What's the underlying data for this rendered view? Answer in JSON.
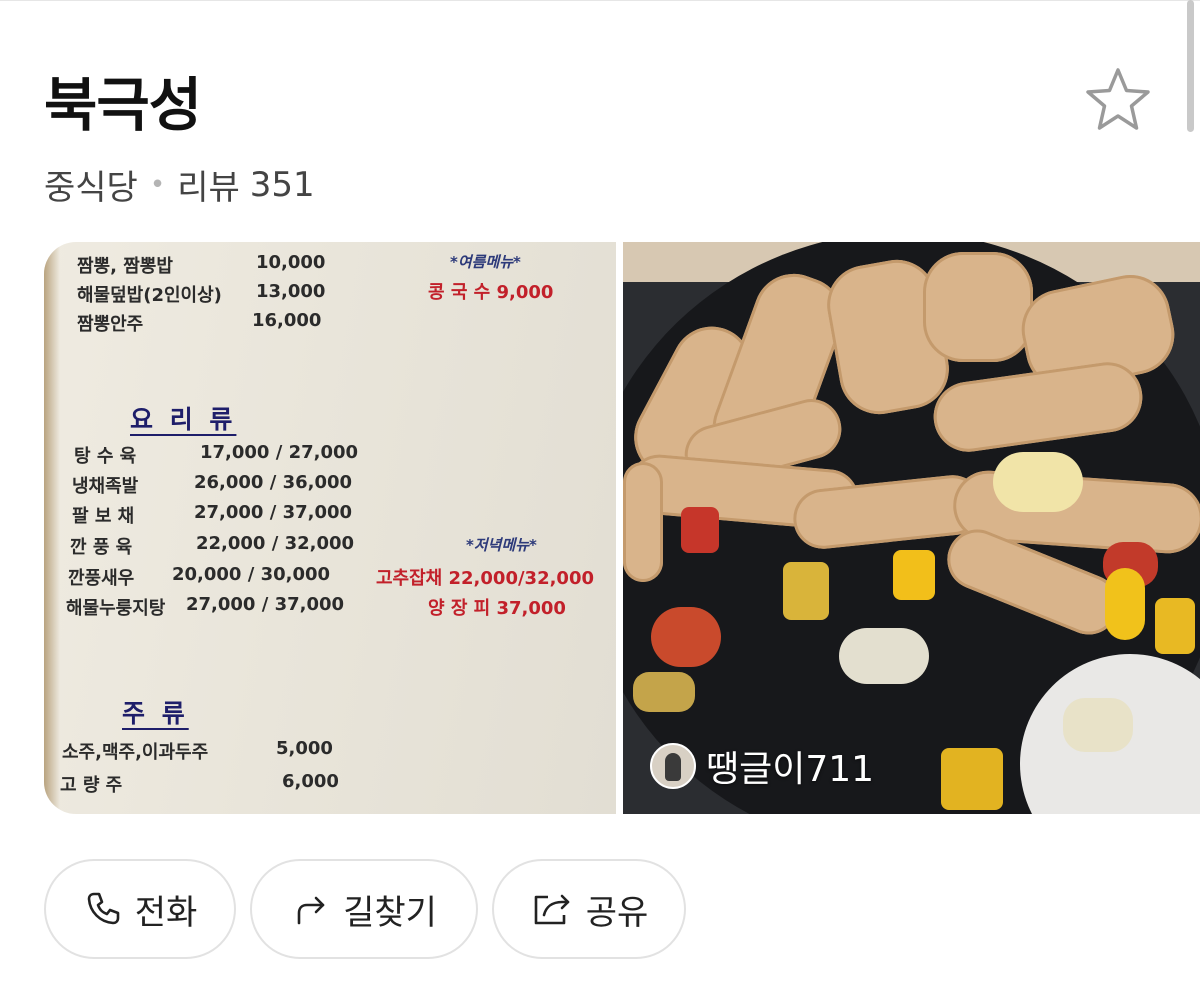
{
  "place": {
    "name": "북극성",
    "category": "중식당",
    "review_label": "리뷰",
    "review_count": "351"
  },
  "icons": {
    "favorite": "star-outline-icon",
    "call": "phone-icon",
    "directions": "route-arrow-icon",
    "share": "share-icon"
  },
  "menu_photo": {
    "rows": [
      {
        "name": "짬뽕, 짬뽕밥",
        "price": "10,000"
      },
      {
        "name": "해물덮밥(2인이상)",
        "price": "13,000"
      },
      {
        "name": "짬뽕안주",
        "price": "16,000"
      }
    ],
    "summer_title": "*여름메뉴*",
    "summer_item": "콩 국 수 9,000",
    "dishes_title": "요 리 류",
    "dishes": [
      {
        "name": "탕 수 육",
        "price": "17,000  /  27,000"
      },
      {
        "name": "냉채족발",
        "price": "26,000  /  36,000"
      },
      {
        "name": "팔 보 채",
        "price": "27,000  /  37,000"
      },
      {
        "name": "깐 풍 육",
        "price": "22,000  /  32,000"
      },
      {
        "name": "깐풍새우",
        "price": "20,000  /  30,000"
      },
      {
        "name": "해물누룽지탕",
        "price": "27,000  /  37,000"
      }
    ],
    "dinner_title": "*저녁메뉴*",
    "dinner_items": [
      "고추잡채  22,000/32,000",
      "양 장 피  37,000"
    ],
    "drinks_title": "주  류",
    "drinks": [
      {
        "name": "소주,맥주,이과두주",
        "price": "5,000"
      },
      {
        "name": "고 량 주",
        "price": "6,000"
      }
    ]
  },
  "food_photo": {
    "uploader": "땡글이711"
  },
  "actions": {
    "call": "전화",
    "directions": "길찾기",
    "share": "공유"
  },
  "colors": {
    "menu_red": "#c2202a",
    "menu_blue": "#2d3a7a",
    "button_border": "#e2e2e2"
  }
}
